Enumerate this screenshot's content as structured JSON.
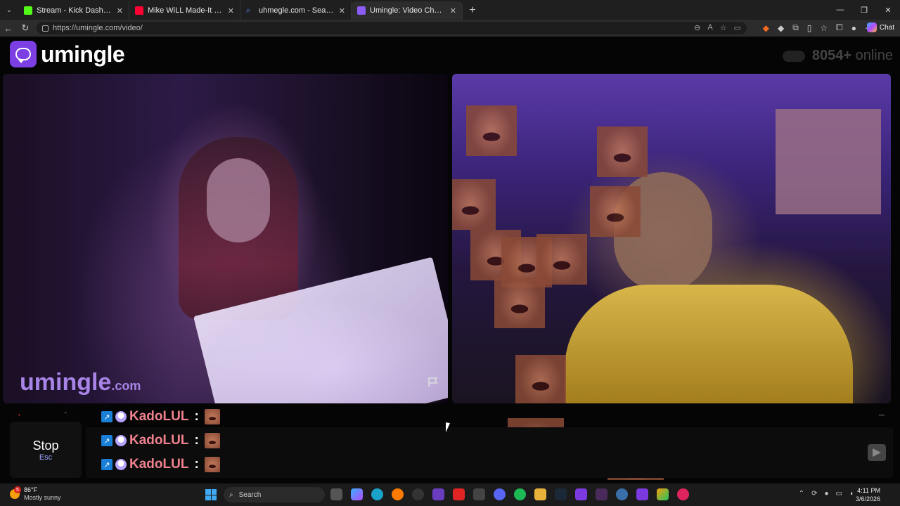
{
  "browser": {
    "tabs": [
      {
        "label": "Stream - Kick Dashboard",
        "color": "#53fc18",
        "active": false
      },
      {
        "label": "Mike WiLL Made-It - Choppin' Bla",
        "color": "#ff0033",
        "active": false
      },
      {
        "label": "uhmegle.com - Search",
        "color": "#5b8cff",
        "active": false
      },
      {
        "label": "Umingle: Video Chat with Stra",
        "color": "#8b5cf6",
        "active": true
      }
    ],
    "url": "https://umingle.com/video/",
    "chat_button": "Chat"
  },
  "site": {
    "logo_text": "umingle",
    "online_count": "8054+",
    "online_label": "online",
    "watermark_main": "umingle",
    "watermark_suffix": ".com"
  },
  "chat": {
    "messages": [
      {
        "user": "KadoLUL",
        "sep": ":"
      },
      {
        "user": "KadoLUL",
        "sep": ":"
      },
      {
        "user": "KadoLUL",
        "sep": ":"
      }
    ],
    "stop_label": "Stop",
    "stop_hint": "Esc"
  },
  "taskbar": {
    "weather_temp": "86°F",
    "weather_desc": "Mostly sunny",
    "weather_alert_count": "5",
    "search_placeholder": "Search",
    "time": "4:11 PM",
    "date": "3/6/2026"
  },
  "colors": {
    "brand": "#7b3fe4",
    "username": "#f0828e"
  }
}
